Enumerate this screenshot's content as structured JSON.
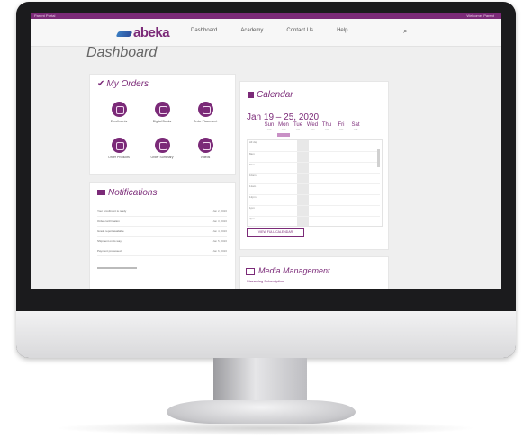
{
  "header": {
    "brand": "abeka",
    "topstrip_left": "Parent Portal",
    "topstrip_right": "Welcome, Parent",
    "nav": [
      "Dashboard",
      "Academy",
      "Contact Us",
      "Help"
    ]
  },
  "page": {
    "title": "Dashboard"
  },
  "orders": {
    "title": "My Orders",
    "items": [
      {
        "label": "Enrollments",
        "icon": "people-icon"
      },
      {
        "label": "Digital Books",
        "icon": "book-icon"
      },
      {
        "label": "Order Placement",
        "icon": "checklist-icon"
      },
      {
        "label": "Order Products",
        "icon": "tablet-icon"
      },
      {
        "label": "Order Summary",
        "icon": "grid-icon"
      },
      {
        "label": "Videos",
        "icon": "play-icon"
      }
    ]
  },
  "notifications": {
    "title": "Notifications",
    "rows": [
      {
        "text": "Your enrollment is ready",
        "date": "Jan 2, 2020"
      },
      {
        "text": "Order confirmation",
        "date": "Jan 3, 2020"
      },
      {
        "text": "Grade report available",
        "date": "Jan 4, 2020"
      },
      {
        "text": "Shipment on its way",
        "date": "Jan 5, 2020"
      },
      {
        "text": "Payment processed",
        "date": "Jan 6, 2020"
      }
    ]
  },
  "calendar": {
    "title": "Calendar",
    "range": "Jan 19 – 25, 2020",
    "days": [
      "Sun",
      "Mon",
      "Tue",
      "Wed",
      "Thu",
      "Fri",
      "Sat"
    ],
    "dates": [
      "1/19",
      "1/20",
      "1/21",
      "1/22",
      "1/23",
      "1/24",
      "1/25"
    ],
    "hours": [
      "All day",
      "8am",
      "9am",
      "10am",
      "11am",
      "12pm",
      "1pm",
      "2pm"
    ],
    "button": "VIEW FULL CALENDAR"
  },
  "media": {
    "title": "Media Management",
    "subtitle": "Streaming Subscription"
  }
}
